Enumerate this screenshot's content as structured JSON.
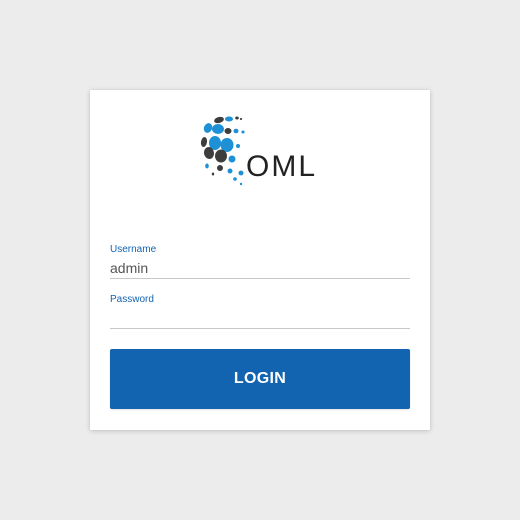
{
  "app": {
    "logo_text": "OML"
  },
  "form": {
    "username": {
      "label": "Username",
      "value": "admin"
    },
    "password": {
      "label": "Password",
      "value": ""
    },
    "login_label": "LOGIN"
  },
  "colors": {
    "background": "#ececec",
    "card": "#ffffff",
    "accent": "#1264b0",
    "logo_blue": "#1e90d6",
    "logo_dark": "#3d3d3d"
  },
  "icons": {
    "logo": "oml-dotted-globe-logo"
  }
}
